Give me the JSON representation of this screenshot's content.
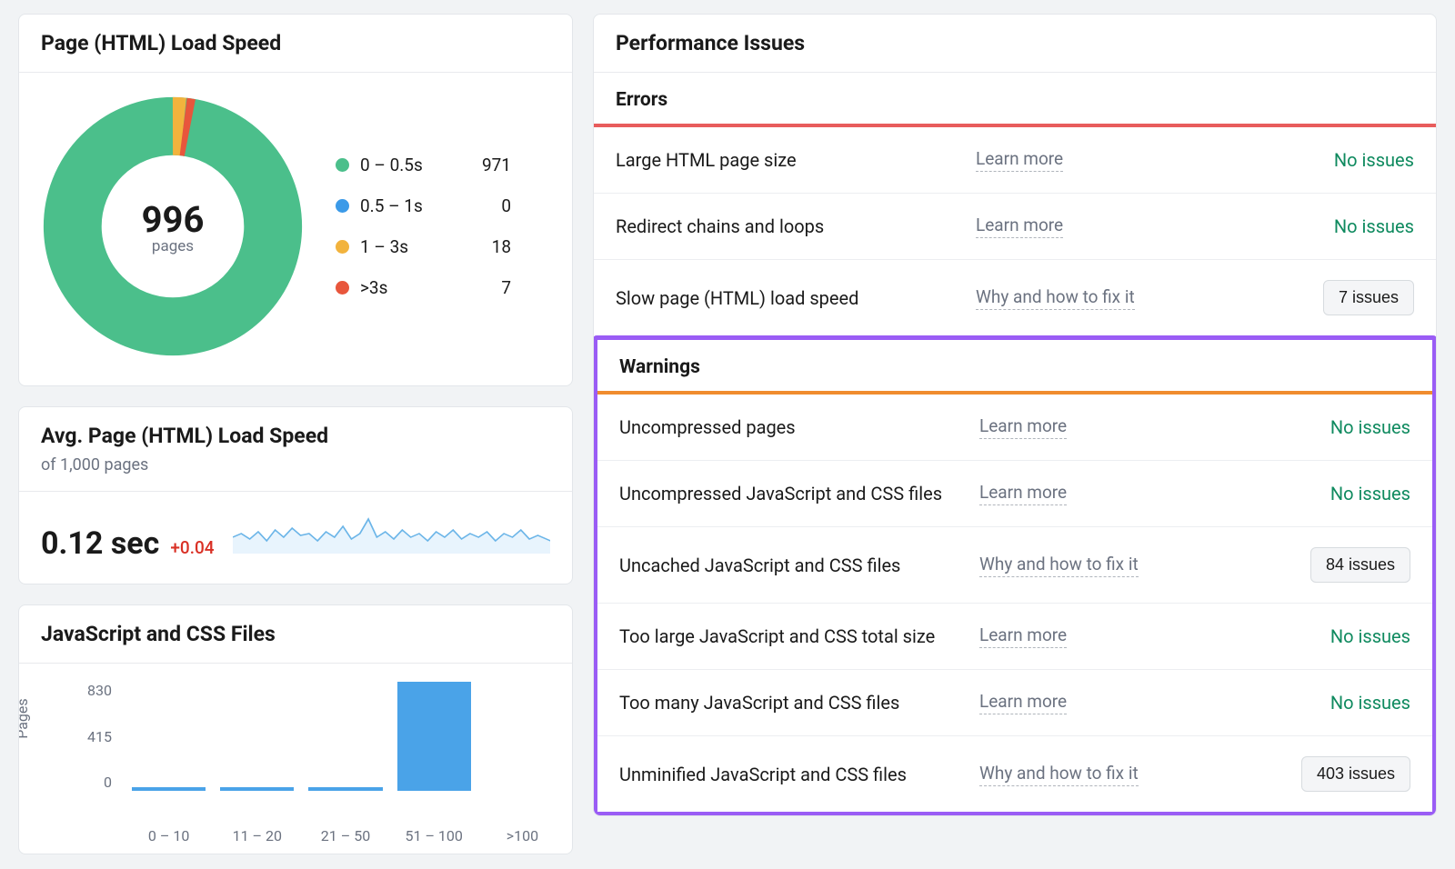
{
  "load_speed": {
    "title": "Page (HTML) Load Speed",
    "total": "996",
    "total_label": "pages",
    "buckets": [
      {
        "range": "0 – 0.5s",
        "value": "971",
        "color": "#4bbf8b"
      },
      {
        "range": "0.5 – 1s",
        "value": "0",
        "color": "#3b9ae8"
      },
      {
        "range": "1 – 3s",
        "value": "18",
        "color": "#f2b33d"
      },
      {
        "range": ">3s",
        "value": "7",
        "color": "#e8563c"
      }
    ]
  },
  "avg_speed": {
    "title": "Avg. Page (HTML) Load Speed",
    "subtitle": "of 1,000 pages",
    "value": "0.12 sec",
    "delta": "+0.04"
  },
  "js_css": {
    "title": "JavaScript and CSS Files",
    "y_label": "Pages"
  },
  "chart_data": {
    "type": "bar",
    "title": "JavaScript and CSS Files",
    "xlabel": "",
    "ylabel": "Pages",
    "ylim": [
      0,
      830
    ],
    "y_ticks": [
      830,
      415,
      0
    ],
    "categories": [
      "0 – 10",
      "11 – 20",
      "21 – 50",
      "51 – 100",
      ">100"
    ],
    "values": [
      10,
      10,
      10,
      830,
      0
    ]
  },
  "performance": {
    "title": "Performance Issues",
    "errors_label": "Errors",
    "warnings_label": "Warnings",
    "learn_more": "Learn more",
    "why_fix": "Why and how to fix it",
    "no_issues": "No issues",
    "errors": [
      {
        "name": "Large HTML page size",
        "link_type": "learn",
        "status": "none"
      },
      {
        "name": "Redirect chains and loops",
        "link_type": "learn",
        "status": "none"
      },
      {
        "name": "Slow page (HTML) load speed",
        "link_type": "fix",
        "status": "7 issues"
      }
    ],
    "warnings": [
      {
        "name": "Uncompressed pages",
        "link_type": "learn",
        "status": "none"
      },
      {
        "name": "Uncompressed JavaScript and CSS files",
        "link_type": "learn",
        "status": "none"
      },
      {
        "name": "Uncached JavaScript and CSS files",
        "link_type": "fix",
        "status": "84 issues"
      },
      {
        "name": "Too large JavaScript and CSS total size",
        "link_type": "learn",
        "status": "none"
      },
      {
        "name": "Too many JavaScript and CSS files",
        "link_type": "learn",
        "status": "none"
      },
      {
        "name": "Unminified JavaScript and CSS files",
        "link_type": "fix",
        "status": "403 issues"
      }
    ]
  }
}
